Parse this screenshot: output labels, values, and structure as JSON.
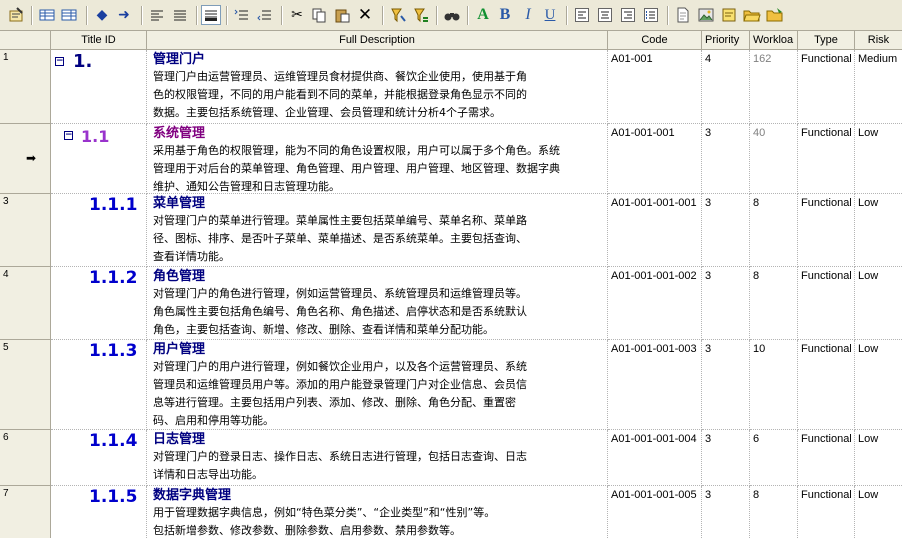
{
  "toolbar": {
    "icons": [
      "properties-icon",
      "insert-row-icon",
      "insert-column-icon",
      "move-left-icon",
      "move-right-icon",
      "align-left-icon",
      "justify-icon",
      "text-wrap-icon",
      "list-collapse-icon",
      "list-expand-icon",
      "cut-icon",
      "copy-icon",
      "paste-icon",
      "delete-icon",
      "filter-icon",
      "filter-clear-icon",
      "find-icon",
      "font-color-icon",
      "bold-icon",
      "italic-icon",
      "underline-icon",
      "align-left-text-icon",
      "align-center-text-icon",
      "align-right-text-icon",
      "bullet-list-icon",
      "new-document-icon",
      "image-icon",
      "note-icon",
      "open-folder-icon",
      "save-folder-icon"
    ]
  },
  "columns": {
    "title_id": "Title ID",
    "desc": "Full Description",
    "code": "Code",
    "priority": "Priority",
    "workload": "Workloa",
    "type": "Type",
    "risk": "Risk"
  },
  "rows": [
    {
      "rownum": "1",
      "num": "1.",
      "title": "管理门户",
      "lines": [
        "管理门户由运营管理员、运维管理员食材提供商、餐饮企业使用，使用基于角",
        "色的权限管理，不同的用户能看到不同的菜单，并能根据登录角色显示不同的",
        "数据。主要包括系统管理、企业管理、会员管理和统计分析4个子需求。"
      ],
      "code": "A01-001",
      "priority": "4",
      "workload": "162",
      "type": "Functional",
      "risk": "Medium"
    },
    {
      "rownum": "",
      "num": "1.1",
      "title": "系统管理",
      "lines": [
        "采用基于角色的权限管理，能为不同的角色设置权限，用户可以属于多个角色。系统",
        "管理用于对后台的菜单管理、角色管理、用户管理、用户管理、地区管理、数据字典",
        "维护、通知公告管理和日志管理功能。"
      ],
      "code": "A01-001-001",
      "priority": "3",
      "workload": "40",
      "type": "Functional",
      "risk": "Low"
    },
    {
      "rownum": "3",
      "num": "1.1.1",
      "title": "菜单管理",
      "lines": [
        "对管理门户的菜单进行管理。菜单属性主要包括菜单编号、菜单名称、菜单路",
        "径、图标、排序、是否叶子菜单、菜单描述、是否系统菜单。主要包括查询、",
        "查看详情功能。"
      ],
      "code": "A01-001-001-001",
      "priority": "3",
      "workload": "8",
      "type": "Functional",
      "risk": "Low"
    },
    {
      "rownum": "4",
      "num": "1.1.2",
      "title": "角色管理",
      "lines": [
        "对管理门户的角色进行管理，例如运营管理员、系统管理员和运维管理员等。",
        "角色属性主要包括角色编号、角色名称、角色描述、启停状态和是否系统默认",
        "角色，主要包括查询、新增、修改、删除、查看详情和菜单分配功能。"
      ],
      "code": "A01-001-001-002",
      "priority": "3",
      "workload": "8",
      "type": "Functional",
      "risk": "Low"
    },
    {
      "rownum": "5",
      "num": "1.1.3",
      "title": "用户管理",
      "lines": [
        "对管理门户的用户进行管理，例如餐饮企业用户，以及各个运营管理员、系统",
        "管理员和运维管理员用户等。添加的用户能登录管理门户对企业信息、会员信",
        "息等进行管理。主要包括用户列表、添加、修改、删除、角色分配、重置密",
        "码、启用和停用等功能。"
      ],
      "code": "A01-001-001-003",
      "priority": "3",
      "workload": "10",
      "type": "Functional",
      "risk": "Low"
    },
    {
      "rownum": "6",
      "num": "1.1.4",
      "title": "日志管理",
      "lines": [
        "对管理门户的登录日志、操作日志、系统日志进行管理，包括日志查询、日志",
        "详情和日志导出功能。"
      ],
      "code": "A01-001-001-004",
      "priority": "3",
      "workload": "6",
      "type": "Functional",
      "risk": "Low"
    },
    {
      "rownum": "7",
      "num": "1.1.5",
      "title": "数据字典管理",
      "lines": [
        "用于管理数据字典信息，例如“特色菜分类”、“企业类型”和“性别”等。",
        "包括新增参数、修改参数、删除参数、启用参数、禁用参数等。"
      ],
      "code": "A01-001-001-005",
      "priority": "3",
      "workload": "8",
      "type": "Functional",
      "risk": "Low"
    }
  ]
}
